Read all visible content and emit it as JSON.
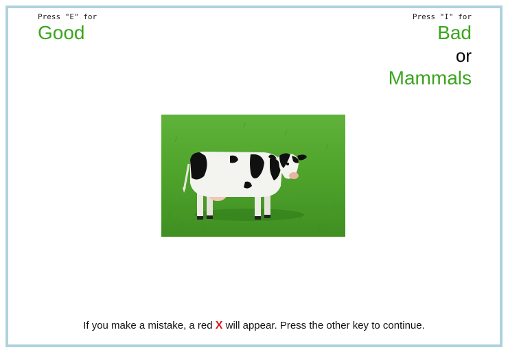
{
  "left": {
    "press_text": "Press \"E\" for",
    "category": "Good"
  },
  "right": {
    "press_text": "Press \"I\" for",
    "category_1": "Bad",
    "connector": "or",
    "category_2": "Mammals"
  },
  "stimulus": {
    "subject": "cow-in-field",
    "colors": {
      "grass": "#4ea32b",
      "cow_white": "#f3f3f0",
      "cow_black": "#101010"
    }
  },
  "instructions": {
    "before": "If you make a mistake, a red ",
    "mark": "X",
    "after": " will appear. Press the other key to continue."
  },
  "colors": {
    "category": "#3aa51c",
    "error_mark": "#e0161c",
    "frame_border": "#acd3dd"
  }
}
